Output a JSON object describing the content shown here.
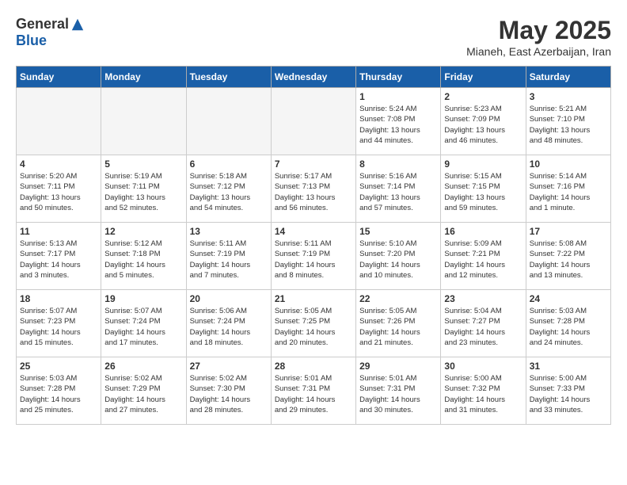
{
  "logo": {
    "general": "General",
    "blue": "Blue"
  },
  "title": "May 2025",
  "location": "Mianeh, East Azerbaijan, Iran",
  "days_of_week": [
    "Sunday",
    "Monday",
    "Tuesday",
    "Wednesday",
    "Thursday",
    "Friday",
    "Saturday"
  ],
  "weeks": [
    [
      {
        "day": "",
        "info": ""
      },
      {
        "day": "",
        "info": ""
      },
      {
        "day": "",
        "info": ""
      },
      {
        "day": "",
        "info": ""
      },
      {
        "day": "1",
        "info": "Sunrise: 5:24 AM\nSunset: 7:08 PM\nDaylight: 13 hours\nand 44 minutes."
      },
      {
        "day": "2",
        "info": "Sunrise: 5:23 AM\nSunset: 7:09 PM\nDaylight: 13 hours\nand 46 minutes."
      },
      {
        "day": "3",
        "info": "Sunrise: 5:21 AM\nSunset: 7:10 PM\nDaylight: 13 hours\nand 48 minutes."
      }
    ],
    [
      {
        "day": "4",
        "info": "Sunrise: 5:20 AM\nSunset: 7:11 PM\nDaylight: 13 hours\nand 50 minutes."
      },
      {
        "day": "5",
        "info": "Sunrise: 5:19 AM\nSunset: 7:11 PM\nDaylight: 13 hours\nand 52 minutes."
      },
      {
        "day": "6",
        "info": "Sunrise: 5:18 AM\nSunset: 7:12 PM\nDaylight: 13 hours\nand 54 minutes."
      },
      {
        "day": "7",
        "info": "Sunrise: 5:17 AM\nSunset: 7:13 PM\nDaylight: 13 hours\nand 56 minutes."
      },
      {
        "day": "8",
        "info": "Sunrise: 5:16 AM\nSunset: 7:14 PM\nDaylight: 13 hours\nand 57 minutes."
      },
      {
        "day": "9",
        "info": "Sunrise: 5:15 AM\nSunset: 7:15 PM\nDaylight: 13 hours\nand 59 minutes."
      },
      {
        "day": "10",
        "info": "Sunrise: 5:14 AM\nSunset: 7:16 PM\nDaylight: 14 hours\nand 1 minute."
      }
    ],
    [
      {
        "day": "11",
        "info": "Sunrise: 5:13 AM\nSunset: 7:17 PM\nDaylight: 14 hours\nand 3 minutes."
      },
      {
        "day": "12",
        "info": "Sunrise: 5:12 AM\nSunset: 7:18 PM\nDaylight: 14 hours\nand 5 minutes."
      },
      {
        "day": "13",
        "info": "Sunrise: 5:11 AM\nSunset: 7:19 PM\nDaylight: 14 hours\nand 7 minutes."
      },
      {
        "day": "14",
        "info": "Sunrise: 5:11 AM\nSunset: 7:19 PM\nDaylight: 14 hours\nand 8 minutes."
      },
      {
        "day": "15",
        "info": "Sunrise: 5:10 AM\nSunset: 7:20 PM\nDaylight: 14 hours\nand 10 minutes."
      },
      {
        "day": "16",
        "info": "Sunrise: 5:09 AM\nSunset: 7:21 PM\nDaylight: 14 hours\nand 12 minutes."
      },
      {
        "day": "17",
        "info": "Sunrise: 5:08 AM\nSunset: 7:22 PM\nDaylight: 14 hours\nand 13 minutes."
      }
    ],
    [
      {
        "day": "18",
        "info": "Sunrise: 5:07 AM\nSunset: 7:23 PM\nDaylight: 14 hours\nand 15 minutes."
      },
      {
        "day": "19",
        "info": "Sunrise: 5:07 AM\nSunset: 7:24 PM\nDaylight: 14 hours\nand 17 minutes."
      },
      {
        "day": "20",
        "info": "Sunrise: 5:06 AM\nSunset: 7:24 PM\nDaylight: 14 hours\nand 18 minutes."
      },
      {
        "day": "21",
        "info": "Sunrise: 5:05 AM\nSunset: 7:25 PM\nDaylight: 14 hours\nand 20 minutes."
      },
      {
        "day": "22",
        "info": "Sunrise: 5:05 AM\nSunset: 7:26 PM\nDaylight: 14 hours\nand 21 minutes."
      },
      {
        "day": "23",
        "info": "Sunrise: 5:04 AM\nSunset: 7:27 PM\nDaylight: 14 hours\nand 23 minutes."
      },
      {
        "day": "24",
        "info": "Sunrise: 5:03 AM\nSunset: 7:28 PM\nDaylight: 14 hours\nand 24 minutes."
      }
    ],
    [
      {
        "day": "25",
        "info": "Sunrise: 5:03 AM\nSunset: 7:28 PM\nDaylight: 14 hours\nand 25 minutes."
      },
      {
        "day": "26",
        "info": "Sunrise: 5:02 AM\nSunset: 7:29 PM\nDaylight: 14 hours\nand 27 minutes."
      },
      {
        "day": "27",
        "info": "Sunrise: 5:02 AM\nSunset: 7:30 PM\nDaylight: 14 hours\nand 28 minutes."
      },
      {
        "day": "28",
        "info": "Sunrise: 5:01 AM\nSunset: 7:31 PM\nDaylight: 14 hours\nand 29 minutes."
      },
      {
        "day": "29",
        "info": "Sunrise: 5:01 AM\nSunset: 7:31 PM\nDaylight: 14 hours\nand 30 minutes."
      },
      {
        "day": "30",
        "info": "Sunrise: 5:00 AM\nSunset: 7:32 PM\nDaylight: 14 hours\nand 31 minutes."
      },
      {
        "day": "31",
        "info": "Sunrise: 5:00 AM\nSunset: 7:33 PM\nDaylight: 14 hours\nand 33 minutes."
      }
    ]
  ]
}
